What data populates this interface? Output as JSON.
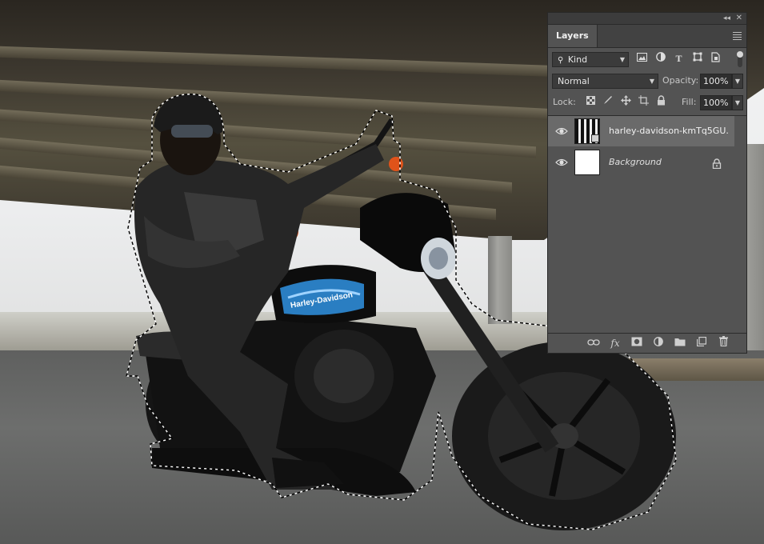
{
  "panel": {
    "collapse_glyph": "◂◂",
    "close_glyph": "✕",
    "tab_label": "Layers",
    "filter": {
      "kind_label": "Kind",
      "icons": [
        "image-filter-icon",
        "adjustment-filter-icon",
        "type-filter-icon",
        "shape-filter-icon",
        "smart-object-filter-icon"
      ]
    },
    "blend_mode": "Normal",
    "opacity_label": "Opacity:",
    "opacity_value": "100%",
    "lock_label": "Lock:",
    "lock_icons": [
      "lock-transparent-pixels-icon",
      "lock-image-pixels-icon",
      "lock-position-icon",
      "lock-artboard-icon",
      "lock-all-icon"
    ],
    "fill_label": "Fill:",
    "fill_value": "100%",
    "layers": [
      {
        "name": "harley-davidson-kmTq5GU...",
        "selected": true,
        "visible": true,
        "type": "smart-object"
      },
      {
        "name": "Background",
        "selected": false,
        "visible": true,
        "locked": true,
        "type": "background"
      }
    ],
    "bottom_icons": [
      "link-layers-icon",
      "fx-icon",
      "add-mask-icon",
      "adjustment-layer-icon",
      "new-group-icon",
      "new-layer-icon",
      "trash-icon"
    ]
  },
  "colors": {
    "panel_bg": "#535353",
    "selected_row": "#6a6a6a",
    "tab_bar": "#424242"
  }
}
